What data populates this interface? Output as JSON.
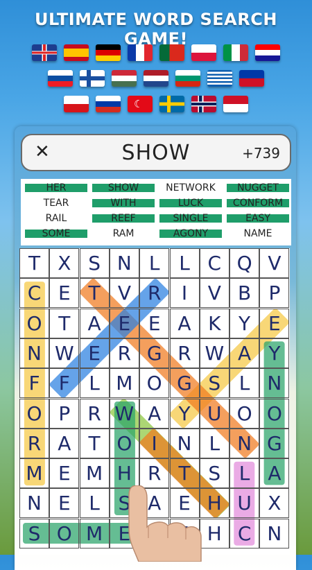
{
  "header": {
    "title": "ULTIMATE WORD SEARCH GAME!"
  },
  "flags": [
    [
      "flag-uk-icon",
      "flag-spain-icon",
      "flag-germany-icon",
      "flag-france-icon",
      "flag-portugal-icon",
      "flag-poland-icon",
      "flag-italy-icon",
      "flag-croatia-icon"
    ],
    [
      "flag-slovakia-icon",
      "flag-finland-icon",
      "flag-hungary-icon",
      "flag-netherlands-icon",
      "flag-bulgaria-icon",
      "flag-greece-icon",
      "flag-philippines-icon"
    ],
    [
      "flag-czech-icon",
      "flag-russia-icon",
      "flag-turkey-icon",
      "flag-sweden-icon",
      "flag-norway-icon",
      "flag-indonesia-icon"
    ]
  ],
  "wordbar": {
    "close_icon": "close-icon",
    "current_word": "SHOW",
    "score": "+739"
  },
  "word_list": [
    {
      "word": "HER",
      "found": true
    },
    {
      "word": "SHOW",
      "found": true
    },
    {
      "word": "NETWORK",
      "found": false
    },
    {
      "word": "NUGGET",
      "found": true
    },
    {
      "word": "TEAR",
      "found": false
    },
    {
      "word": "WITH",
      "found": true
    },
    {
      "word": "LUCK",
      "found": true
    },
    {
      "word": "CONFORM",
      "found": true
    },
    {
      "word": "RAIL",
      "found": false
    },
    {
      "word": "REEF",
      "found": true
    },
    {
      "word": "SINGLE",
      "found": true
    },
    {
      "word": "EASY",
      "found": true
    },
    {
      "word": "SOME",
      "found": true
    },
    {
      "word": "RAM",
      "found": false
    },
    {
      "word": "AGONY",
      "found": true
    },
    {
      "word": "NAME",
      "found": false
    }
  ],
  "grid": [
    [
      "T",
      "X",
      "S",
      "N",
      "L",
      "L",
      "C",
      "Q",
      "V"
    ],
    [
      "C",
      "E",
      "T",
      "V",
      "R",
      "I",
      "V",
      "B",
      "P"
    ],
    [
      "O",
      "T",
      "A",
      "E",
      "E",
      "A",
      "K",
      "Y",
      "E"
    ],
    [
      "N",
      "W",
      "E",
      "R",
      "G",
      "R",
      "W",
      "A",
      "Y"
    ],
    [
      "F",
      "F",
      "L",
      "M",
      "O",
      "G",
      "S",
      "L",
      "N"
    ],
    [
      "O",
      "P",
      "R",
      "W",
      "A",
      "Y",
      "U",
      "O",
      "O"
    ],
    [
      "R",
      "A",
      "T",
      "O",
      "I",
      "N",
      "L",
      "N",
      "G"
    ],
    [
      "M",
      "E",
      "M",
      "H",
      "R",
      "T",
      "S",
      "L",
      "A"
    ],
    [
      "N",
      "E",
      "L",
      "S",
      "A",
      "E",
      "H",
      "U",
      "X"
    ],
    [
      "S",
      "O",
      "M",
      "E",
      "H",
      "S",
      "H",
      "C",
      "N"
    ]
  ],
  "colors": {
    "conform": "#f5c842",
    "agony": "#2aa36a",
    "easy": "#f5c842",
    "nugget": "#f07a1e",
    "reef": "#2a7fe0",
    "single": "#f07a1e",
    "show": "#8cc63f",
    "her": "#f07a1e",
    "luck": "#e28adb",
    "some": "#2aa36a",
    "sign": "#2aa36a"
  }
}
